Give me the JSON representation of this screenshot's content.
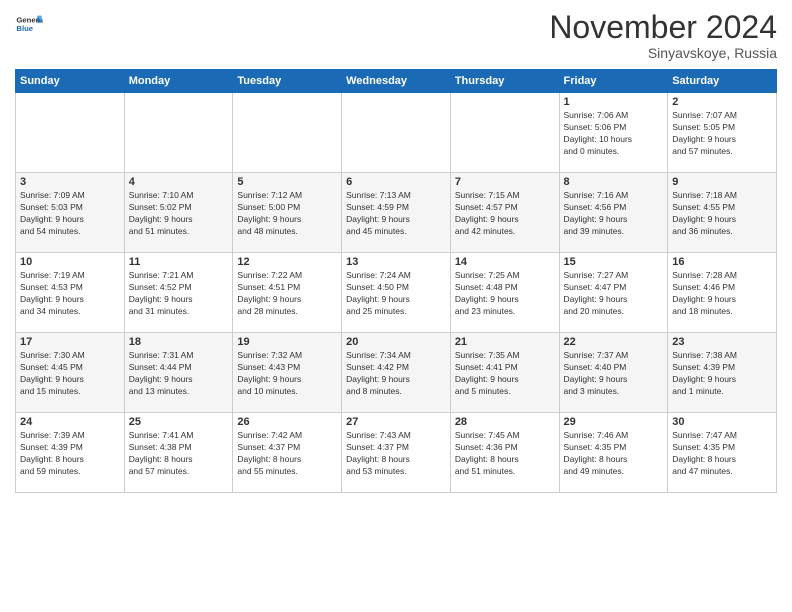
{
  "logo": {
    "general": "General",
    "blue": "Blue"
  },
  "header": {
    "month": "November 2024",
    "location": "Sinyavskoye, Russia"
  },
  "days_of_week": [
    "Sunday",
    "Monday",
    "Tuesday",
    "Wednesday",
    "Thursday",
    "Friday",
    "Saturday"
  ],
  "weeks": [
    [
      {
        "day": "",
        "info": ""
      },
      {
        "day": "",
        "info": ""
      },
      {
        "day": "",
        "info": ""
      },
      {
        "day": "",
        "info": ""
      },
      {
        "day": "",
        "info": ""
      },
      {
        "day": "1",
        "info": "Sunrise: 7:06 AM\nSunset: 5:06 PM\nDaylight: 10 hours\nand 0 minutes."
      },
      {
        "day": "2",
        "info": "Sunrise: 7:07 AM\nSunset: 5:05 PM\nDaylight: 9 hours\nand 57 minutes."
      }
    ],
    [
      {
        "day": "3",
        "info": "Sunrise: 7:09 AM\nSunset: 5:03 PM\nDaylight: 9 hours\nand 54 minutes."
      },
      {
        "day": "4",
        "info": "Sunrise: 7:10 AM\nSunset: 5:02 PM\nDaylight: 9 hours\nand 51 minutes."
      },
      {
        "day": "5",
        "info": "Sunrise: 7:12 AM\nSunset: 5:00 PM\nDaylight: 9 hours\nand 48 minutes."
      },
      {
        "day": "6",
        "info": "Sunrise: 7:13 AM\nSunset: 4:59 PM\nDaylight: 9 hours\nand 45 minutes."
      },
      {
        "day": "7",
        "info": "Sunrise: 7:15 AM\nSunset: 4:57 PM\nDaylight: 9 hours\nand 42 minutes."
      },
      {
        "day": "8",
        "info": "Sunrise: 7:16 AM\nSunset: 4:56 PM\nDaylight: 9 hours\nand 39 minutes."
      },
      {
        "day": "9",
        "info": "Sunrise: 7:18 AM\nSunset: 4:55 PM\nDaylight: 9 hours\nand 36 minutes."
      }
    ],
    [
      {
        "day": "10",
        "info": "Sunrise: 7:19 AM\nSunset: 4:53 PM\nDaylight: 9 hours\nand 34 minutes."
      },
      {
        "day": "11",
        "info": "Sunrise: 7:21 AM\nSunset: 4:52 PM\nDaylight: 9 hours\nand 31 minutes."
      },
      {
        "day": "12",
        "info": "Sunrise: 7:22 AM\nSunset: 4:51 PM\nDaylight: 9 hours\nand 28 minutes."
      },
      {
        "day": "13",
        "info": "Sunrise: 7:24 AM\nSunset: 4:50 PM\nDaylight: 9 hours\nand 25 minutes."
      },
      {
        "day": "14",
        "info": "Sunrise: 7:25 AM\nSunset: 4:48 PM\nDaylight: 9 hours\nand 23 minutes."
      },
      {
        "day": "15",
        "info": "Sunrise: 7:27 AM\nSunset: 4:47 PM\nDaylight: 9 hours\nand 20 minutes."
      },
      {
        "day": "16",
        "info": "Sunrise: 7:28 AM\nSunset: 4:46 PM\nDaylight: 9 hours\nand 18 minutes."
      }
    ],
    [
      {
        "day": "17",
        "info": "Sunrise: 7:30 AM\nSunset: 4:45 PM\nDaylight: 9 hours\nand 15 minutes."
      },
      {
        "day": "18",
        "info": "Sunrise: 7:31 AM\nSunset: 4:44 PM\nDaylight: 9 hours\nand 13 minutes."
      },
      {
        "day": "19",
        "info": "Sunrise: 7:32 AM\nSunset: 4:43 PM\nDaylight: 9 hours\nand 10 minutes."
      },
      {
        "day": "20",
        "info": "Sunrise: 7:34 AM\nSunset: 4:42 PM\nDaylight: 9 hours\nand 8 minutes."
      },
      {
        "day": "21",
        "info": "Sunrise: 7:35 AM\nSunset: 4:41 PM\nDaylight: 9 hours\nand 5 minutes."
      },
      {
        "day": "22",
        "info": "Sunrise: 7:37 AM\nSunset: 4:40 PM\nDaylight: 9 hours\nand 3 minutes."
      },
      {
        "day": "23",
        "info": "Sunrise: 7:38 AM\nSunset: 4:39 PM\nDaylight: 9 hours\nand 1 minute."
      }
    ],
    [
      {
        "day": "24",
        "info": "Sunrise: 7:39 AM\nSunset: 4:39 PM\nDaylight: 8 hours\nand 59 minutes."
      },
      {
        "day": "25",
        "info": "Sunrise: 7:41 AM\nSunset: 4:38 PM\nDaylight: 8 hours\nand 57 minutes."
      },
      {
        "day": "26",
        "info": "Sunrise: 7:42 AM\nSunset: 4:37 PM\nDaylight: 8 hours\nand 55 minutes."
      },
      {
        "day": "27",
        "info": "Sunrise: 7:43 AM\nSunset: 4:37 PM\nDaylight: 8 hours\nand 53 minutes."
      },
      {
        "day": "28",
        "info": "Sunrise: 7:45 AM\nSunset: 4:36 PM\nDaylight: 8 hours\nand 51 minutes."
      },
      {
        "day": "29",
        "info": "Sunrise: 7:46 AM\nSunset: 4:35 PM\nDaylight: 8 hours\nand 49 minutes."
      },
      {
        "day": "30",
        "info": "Sunrise: 7:47 AM\nSunset: 4:35 PM\nDaylight: 8 hours\nand 47 minutes."
      }
    ]
  ]
}
